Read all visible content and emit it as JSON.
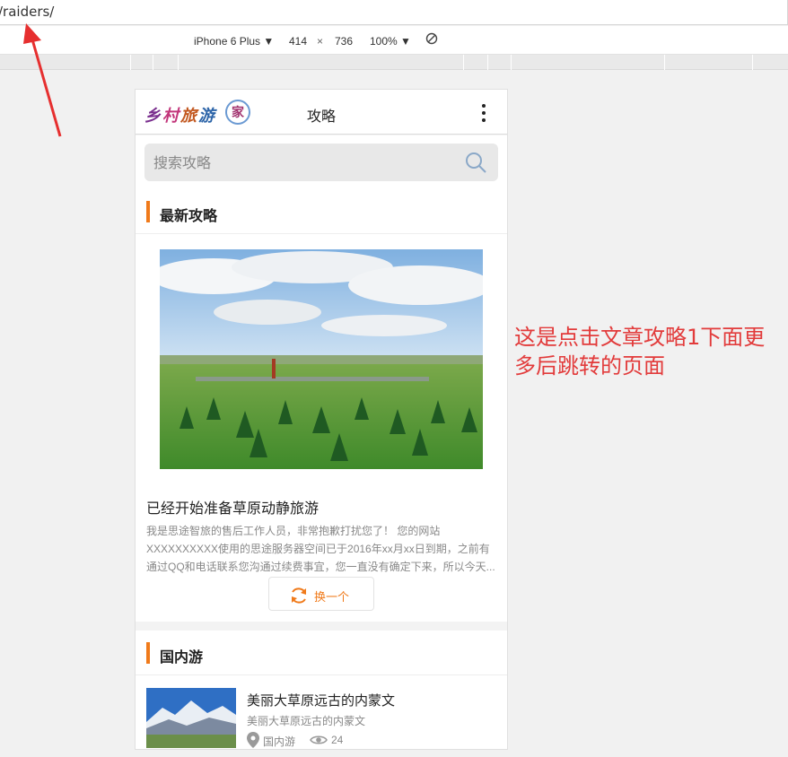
{
  "browser": {
    "url": "/raiders/"
  },
  "devtools": {
    "device": "iPhone 6 Plus",
    "width": "414",
    "times": "×",
    "height": "736",
    "zoom": "100%"
  },
  "app": {
    "logo_text": [
      "乡",
      "村",
      "旅",
      "游"
    ],
    "logo_seal": "家",
    "title": "攻略",
    "search_placeholder": "搜索攻略"
  },
  "latest": {
    "heading": "最新攻略",
    "article_title": "已经开始准备草原动静旅游",
    "article_desc": "我是思途智旅的售后工作人员，非常抱歉打扰您了！ 您的网站XXXXXXXXXX使用的思途服务器空间已于2016年xx月xx日到期，之前有通过QQ和电话联系您沟通过续费事宜，您一直没有确定下来，所以今天...",
    "swap_label": "换一个"
  },
  "domestic": {
    "heading": "国内游",
    "items": [
      {
        "title": "美丽大草原远古的内蒙文",
        "subtitle": "美丽大草原远古的内蒙文",
        "location": "国内游",
        "views": "24"
      }
    ]
  },
  "annotation": "这是点击文章攻略1下面更多后跳转的页面",
  "colors": {
    "accent": "#f07a1a",
    "note": "#e23b3b"
  }
}
